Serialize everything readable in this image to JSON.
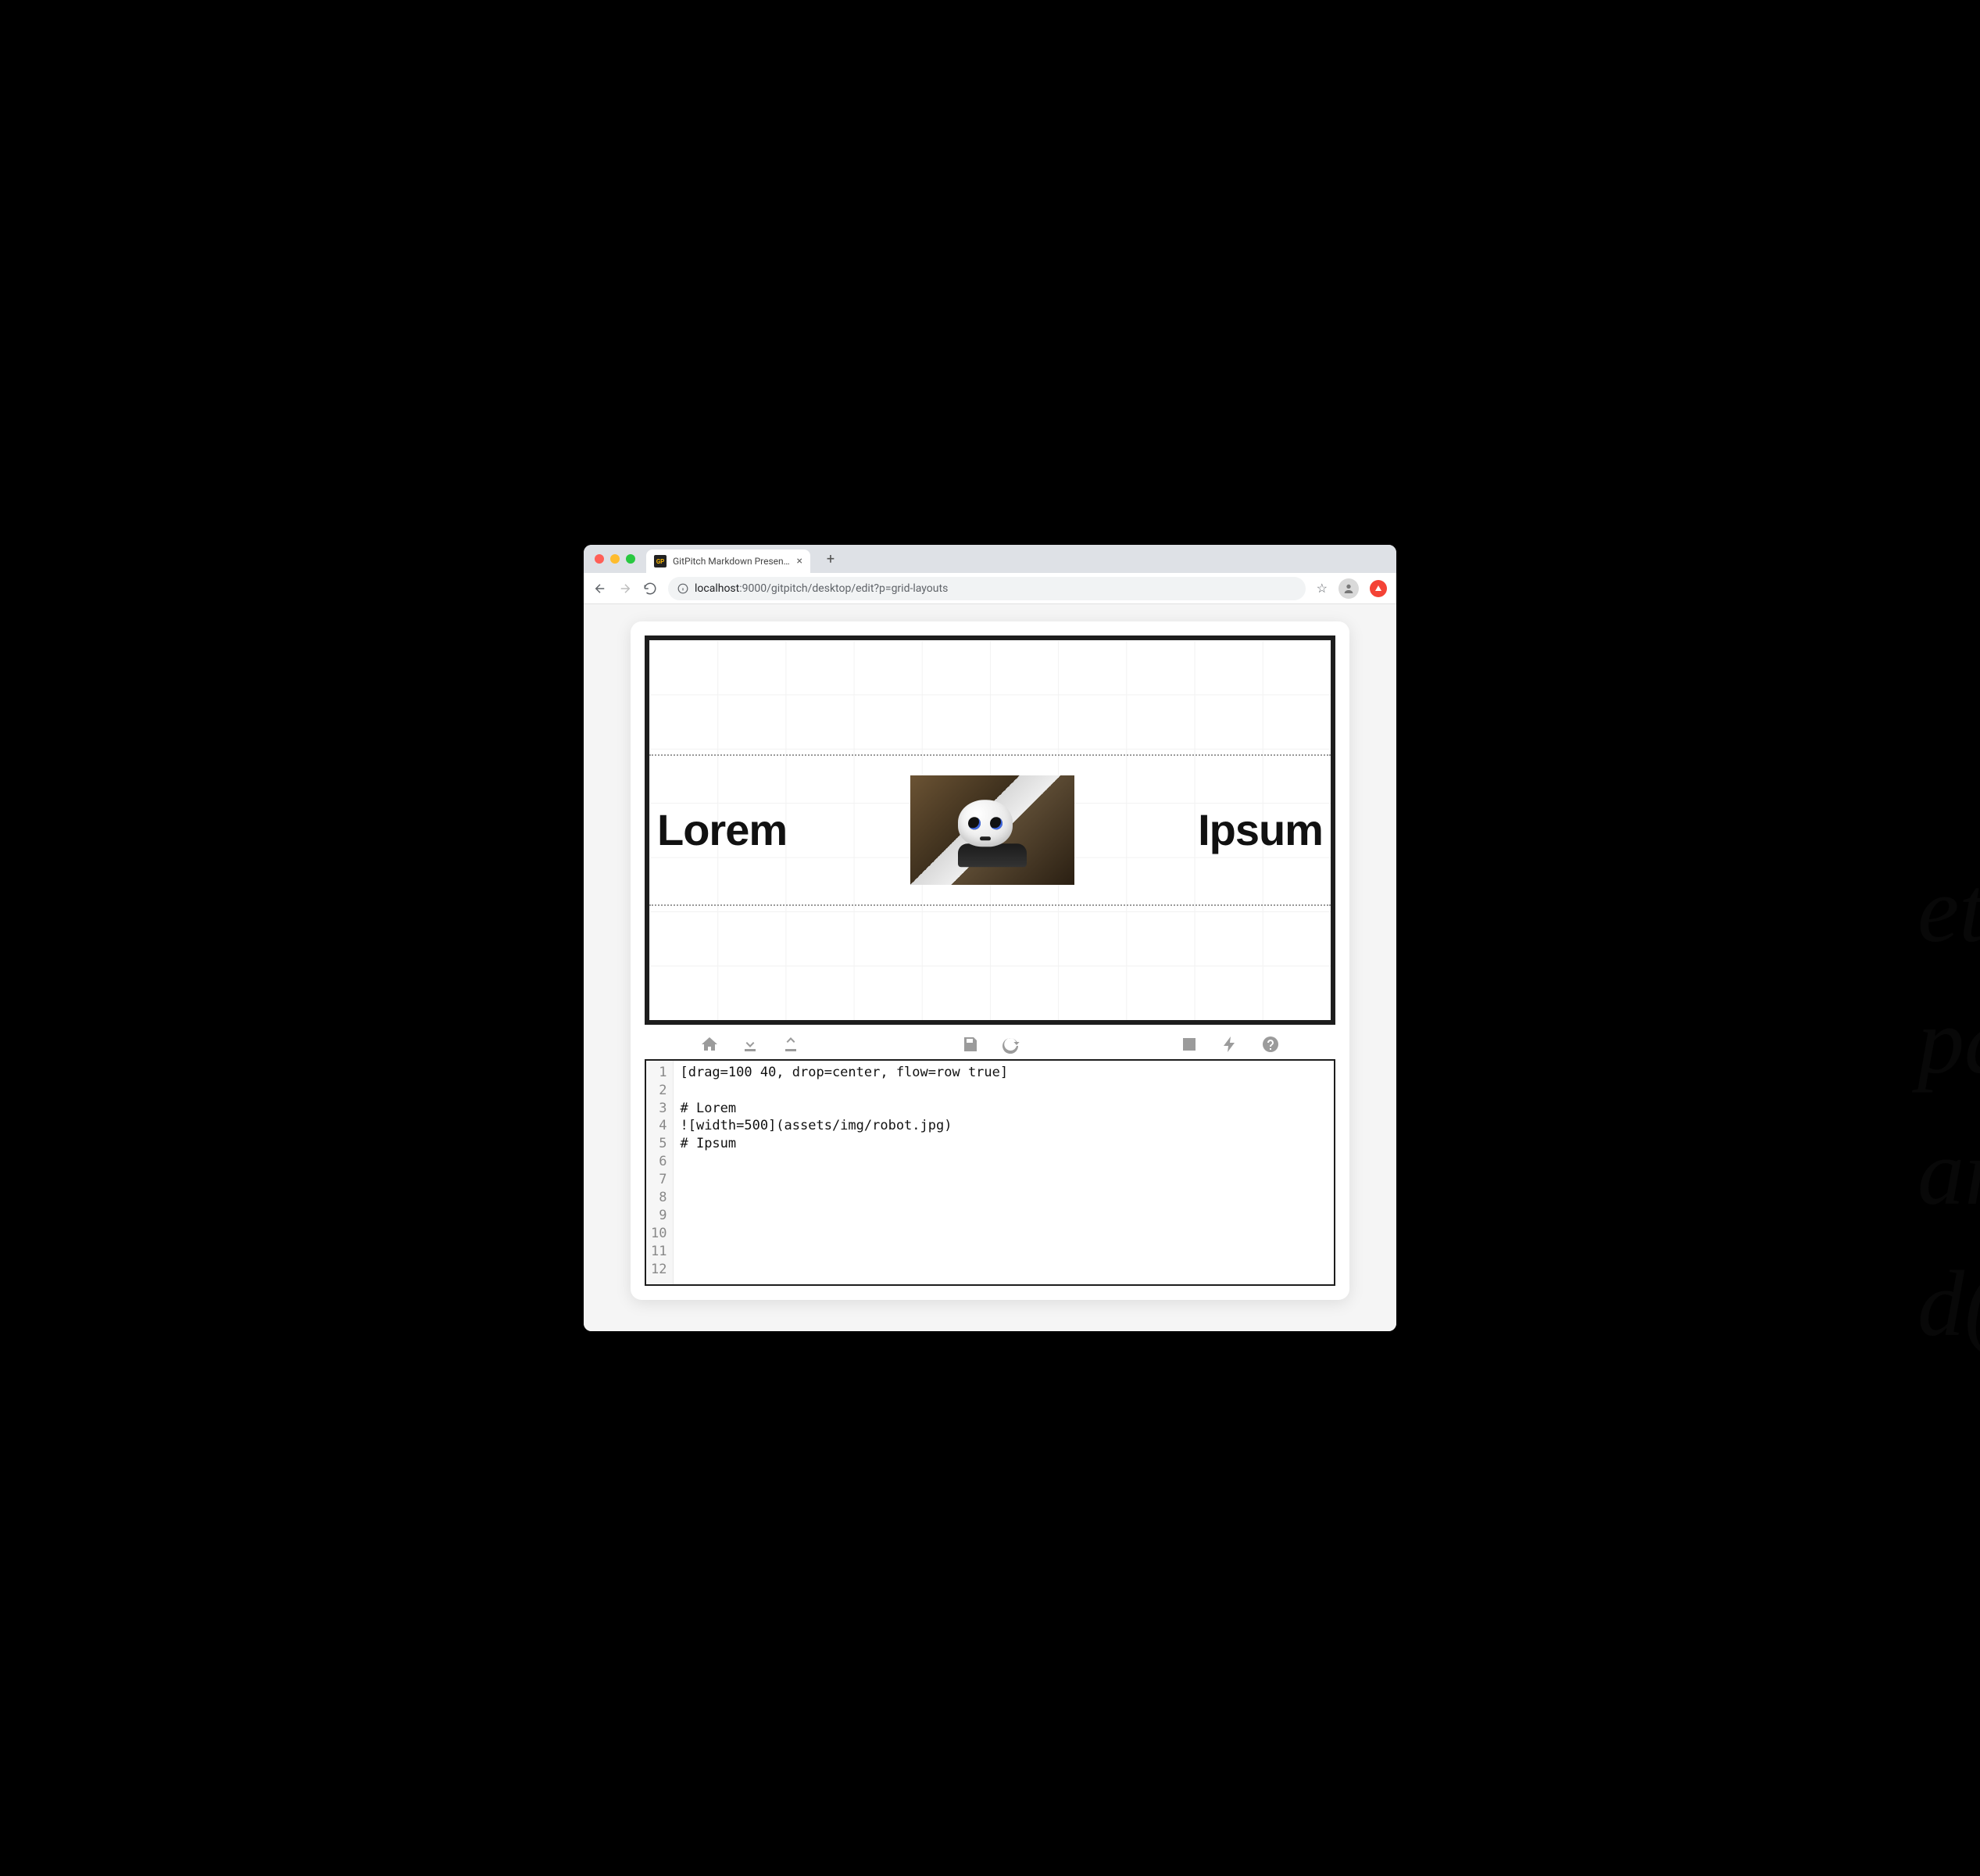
{
  "browser": {
    "tab_title": "GitPitch Markdown Presentatio",
    "url_prefix": "localhost",
    "url_rest": ":9000/gitpitch/desktop/edit?p=grid-layouts"
  },
  "slide": {
    "left_heading": "Lorem",
    "right_heading": "Ipsum",
    "image_alt": "robot"
  },
  "toolbar": {
    "home": "Home",
    "download": "Download",
    "upload": "Upload",
    "save": "Save",
    "refresh": "Refresh",
    "present": "Present",
    "flash": "Quick",
    "help": "Help"
  },
  "editor": {
    "lines": [
      "[drag=100 40, drop=center, flow=row true]",
      "",
      "# Lorem",
      "![width=500](assets/img/robot.jpg)",
      "# Ipsum",
      "",
      "",
      "",
      "",
      "",
      "",
      ""
    ]
  }
}
